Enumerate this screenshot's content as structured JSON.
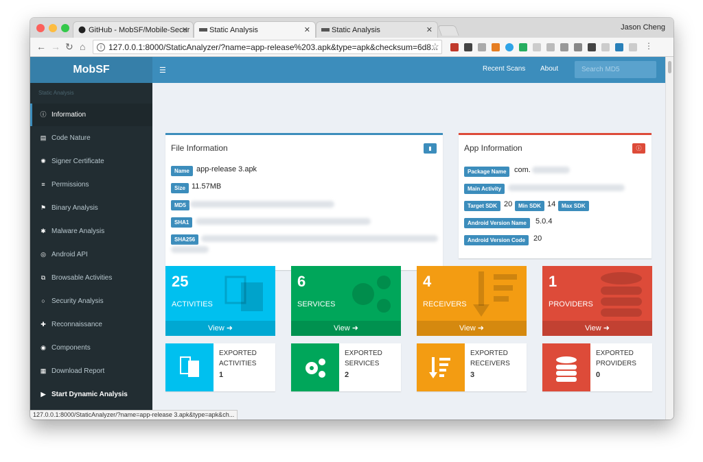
{
  "browser": {
    "tabs": [
      {
        "title": "GitHub - MobSF/Mobile-Secur"
      },
      {
        "title": "Static Analysis"
      },
      {
        "title": "Static Analysis"
      }
    ],
    "user": "Jason Cheng",
    "url": "127.0.0.1:8000/StaticAnalyzer/?name=app-release%203.apk&type=apk&checksum=6d8...",
    "status_url": "127.0.0.1:8000/StaticAnalyzer/?name=app-release 3.apk&type=apk&ch..."
  },
  "sidebar": {
    "logo": "MobSF",
    "header": "Static Analysis",
    "items": [
      {
        "label": "Information",
        "icon": "info-icon"
      },
      {
        "label": "Code Nature",
        "icon": "code-icon"
      },
      {
        "label": "Signer Certificate",
        "icon": "certificate-icon"
      },
      {
        "label": "Permissions",
        "icon": "list-icon"
      },
      {
        "label": "Binary Analysis",
        "icon": "flag-icon"
      },
      {
        "label": "Malware Analysis",
        "icon": "bug-icon"
      },
      {
        "label": "Android API",
        "icon": "api-icon"
      },
      {
        "label": "Browsable Activities",
        "icon": "copy-icon"
      },
      {
        "label": "Security Analysis",
        "icon": "circle-icon"
      },
      {
        "label": "Reconnaissance",
        "icon": "plus-icon"
      },
      {
        "label": "Components",
        "icon": "components-icon"
      },
      {
        "label": "Download Report",
        "icon": "report-icon"
      },
      {
        "label": "Start Dynamic Analysis",
        "icon": "play-icon"
      }
    ]
  },
  "topnav": {
    "recent_scans": "Recent Scans",
    "about": "About",
    "search_placeholder": "Search MD5"
  },
  "file_info": {
    "title": "File Information",
    "name_label": "Name",
    "name_value": "app-release 3.apk",
    "size_label": "Size",
    "size_value": "11.57MB",
    "md5_label": "MD5",
    "sha1_label": "SHA1",
    "sha256_label": "SHA256"
  },
  "app_info": {
    "title": "App Information",
    "package_label": "Package Name",
    "package_value": "com.",
    "main_activity_label": "Main Activity",
    "target_sdk_label": "Target SDK",
    "target_sdk_value": "20",
    "min_sdk_label": "Min SDK",
    "min_sdk_value": "14",
    "max_sdk_label": "Max SDK",
    "version_name_label": "Android Version Name",
    "version_name_value": "5.0.4",
    "version_code_label": "Android Version Code",
    "version_code_value": "20"
  },
  "tiles": [
    {
      "count": "25",
      "label": "ACTIVITIES",
      "view": "View",
      "color": "#00c0ef"
    },
    {
      "count": "6",
      "label": "SERVICES",
      "view": "View",
      "color": "#00a65a"
    },
    {
      "count": "4",
      "label": "RECEIVERS",
      "view": "View",
      "color": "#f39c12"
    },
    {
      "count": "1",
      "label": "PROVIDERS",
      "view": "View",
      "color": "#dd4b39"
    }
  ],
  "exported": [
    {
      "line1": "EXPORTED",
      "line2": "ACTIVITIES",
      "count": "1"
    },
    {
      "line1": "EXPORTED",
      "line2": "SERVICES",
      "count": "2"
    },
    {
      "line1": "EXPORTED",
      "line2": "RECEIVERS",
      "count": "3"
    },
    {
      "line1": "EXPORTED",
      "line2": "PROVIDERS",
      "count": "0"
    }
  ]
}
